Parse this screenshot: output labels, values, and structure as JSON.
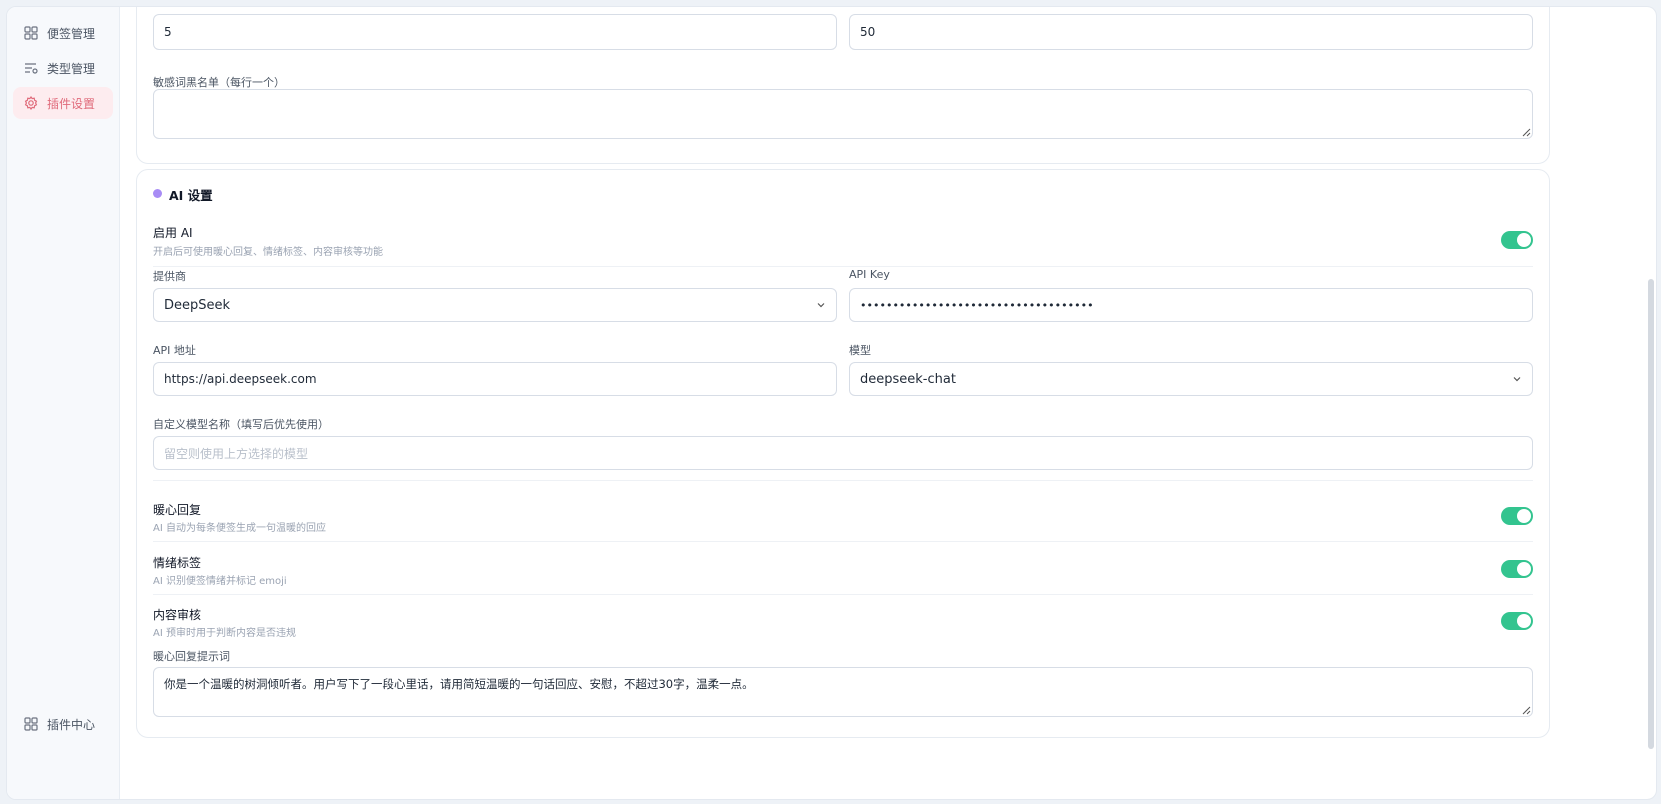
{
  "sidebar": {
    "items": [
      {
        "label": "便签管理",
        "icon": "grid-icon"
      },
      {
        "label": "类型管理",
        "icon": "list-filter-icon"
      },
      {
        "label": "插件设置",
        "icon": "gear-icon"
      }
    ],
    "footer": {
      "label": "插件中心",
      "icon": "grid-icon"
    }
  },
  "top_card": {
    "field_left_value": "5",
    "field_right_value": "50",
    "blacklist_label": "敏感词黑名单（每行一个）",
    "blacklist_value": ""
  },
  "ai_card": {
    "title": "AI 设置",
    "enable": {
      "title": "启用 AI",
      "desc": "开启后可使用暖心回复、情绪标签、内容审核等功能",
      "on": true
    },
    "provider": {
      "label": "提供商",
      "value": "DeepSeek"
    },
    "api_key": {
      "label": "API Key",
      "value": "••••••••••••••••••••••••••••••••••••"
    },
    "api_url": {
      "label": "API 地址",
      "value": "https://api.deepseek.com"
    },
    "model": {
      "label": "模型",
      "value": "deepseek-chat"
    },
    "custom_model": {
      "label": "自定义模型名称（填写后优先使用）",
      "placeholder": "留空则使用上方选择的模型"
    },
    "warm_reply": {
      "title": "暖心回复",
      "desc": "AI 自动为每条便签生成一句温暖的回应",
      "on": true
    },
    "emotion_tag": {
      "title": "情绪标签",
      "desc": "AI 识别便签情绪并标记 emoji",
      "on": true
    },
    "moderation": {
      "title": "内容审核",
      "desc": "AI 预审时用于判断内容是否违规",
      "on": true
    },
    "prompt": {
      "label": "暖心回复提示词",
      "value": "你是一个温暖的树洞倾听者。用户写下了一段心里话，请用简短温暖的一句话回应、安慰，不超过30字，温柔一点。"
    }
  },
  "colors": {
    "accent": "#e06a7a",
    "toggle_on": "#33c48f",
    "section_dot": "#a88cf5"
  }
}
